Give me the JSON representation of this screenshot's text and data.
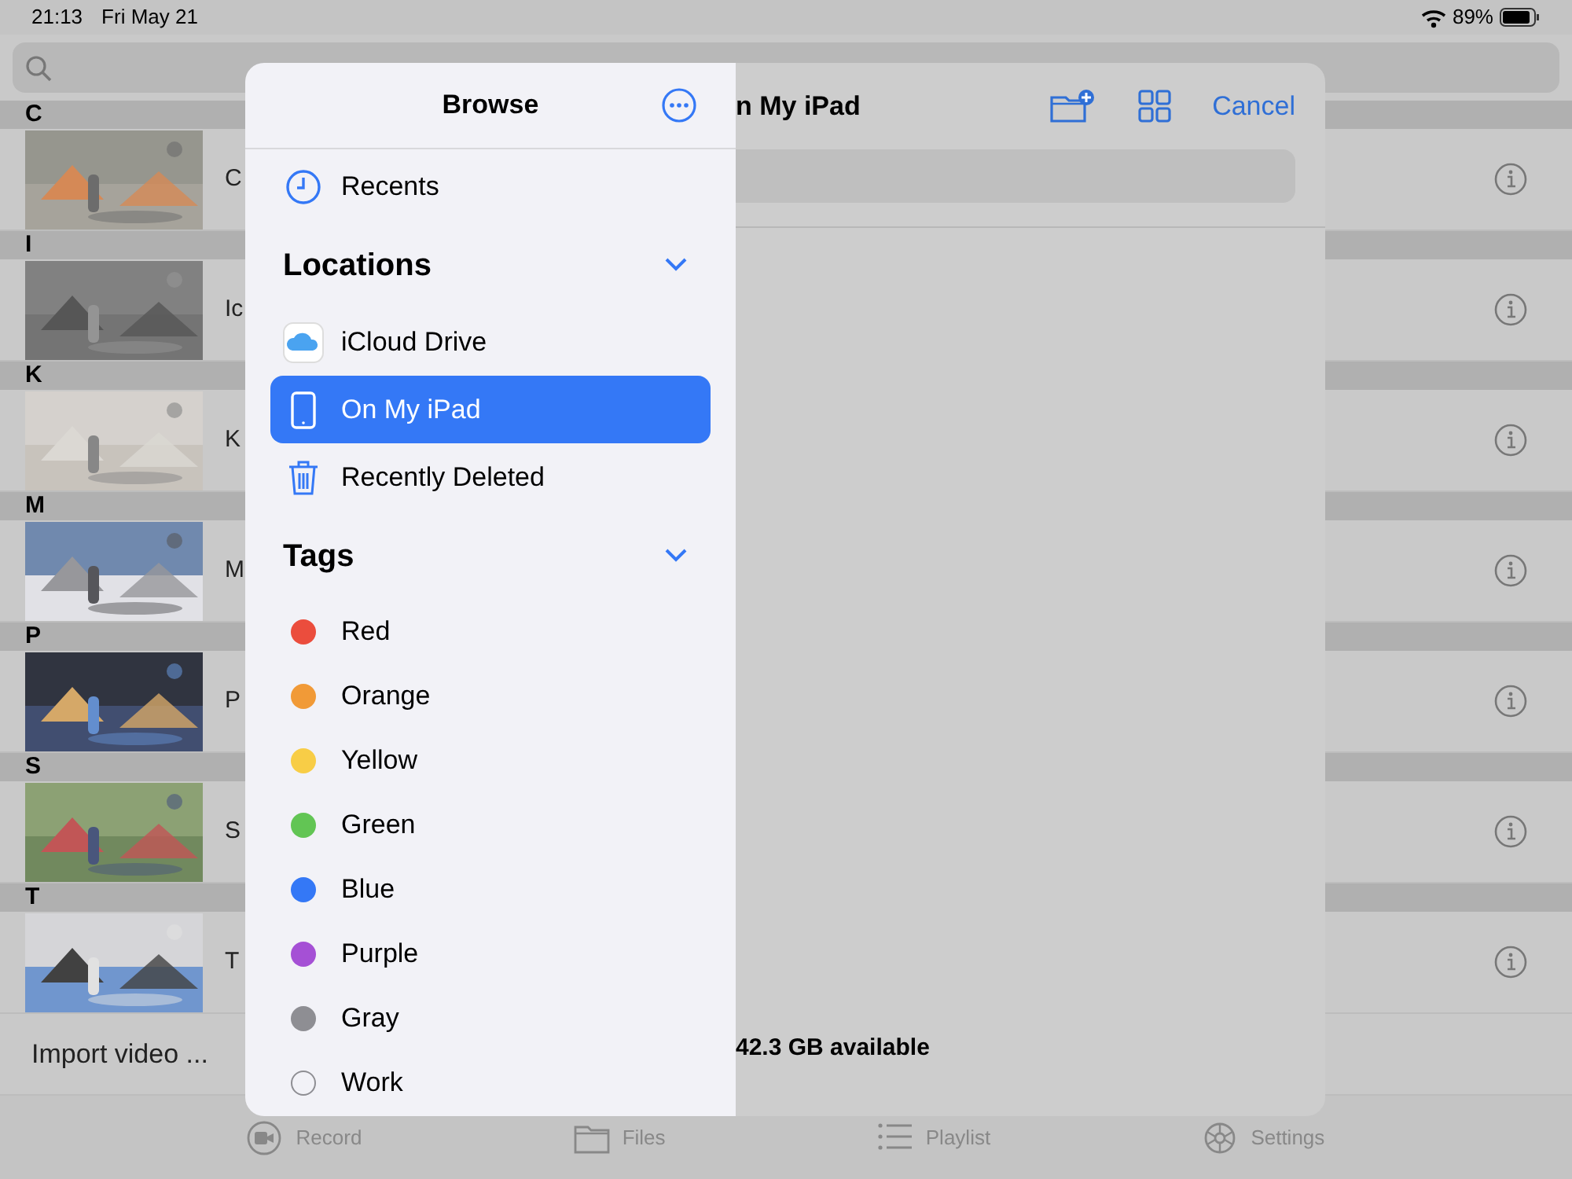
{
  "status_bar": {
    "time": "21:13",
    "date": "Fri May 21",
    "battery": "89%"
  },
  "sections": [
    {
      "letter": "C",
      "title": "C"
    },
    {
      "letter": "I",
      "title": "Ic"
    },
    {
      "letter": "K",
      "title": "K"
    },
    {
      "letter": "M",
      "title": "M"
    },
    {
      "letter": "P",
      "title": "P"
    },
    {
      "letter": "S",
      "title": "S"
    },
    {
      "letter": "T",
      "title": "T"
    }
  ],
  "import_label": "Import video ...",
  "tab_bar": [
    {
      "label": "Record",
      "kind": "record"
    },
    {
      "label": "Files",
      "kind": "files"
    },
    {
      "label": "Playlist",
      "kind": "playlist"
    },
    {
      "label": "Settings",
      "kind": "settings"
    }
  ],
  "browser": {
    "title": "Browse",
    "recents": "Recents",
    "locations": {
      "title": "Locations",
      "expanded": true,
      "items": [
        {
          "label": "iCloud Drive",
          "kind": "cloud",
          "selected": false
        },
        {
          "label": "On My iPad",
          "kind": "ipad",
          "selected": true
        },
        {
          "label": "Recently Deleted",
          "kind": "trash",
          "selected": false
        }
      ]
    },
    "tags": {
      "title": "Tags",
      "expanded": true,
      "items": [
        {
          "label": "Red",
          "color": "#eb4d3d"
        },
        {
          "label": "Orange",
          "color": "#f19a37"
        },
        {
          "label": "Yellow",
          "color": "#f8cd46"
        },
        {
          "label": "Green",
          "color": "#62c554"
        },
        {
          "label": "Blue",
          "color": "#3478f6"
        },
        {
          "label": "Purple",
          "color": "#a550d5"
        },
        {
          "label": "Gray",
          "color": "#8e8e93"
        },
        {
          "label": "Work"
        }
      ]
    }
  },
  "folder": {
    "title": "n My iPad",
    "cancel": "Cancel",
    "storage": "42.3 GB available"
  }
}
